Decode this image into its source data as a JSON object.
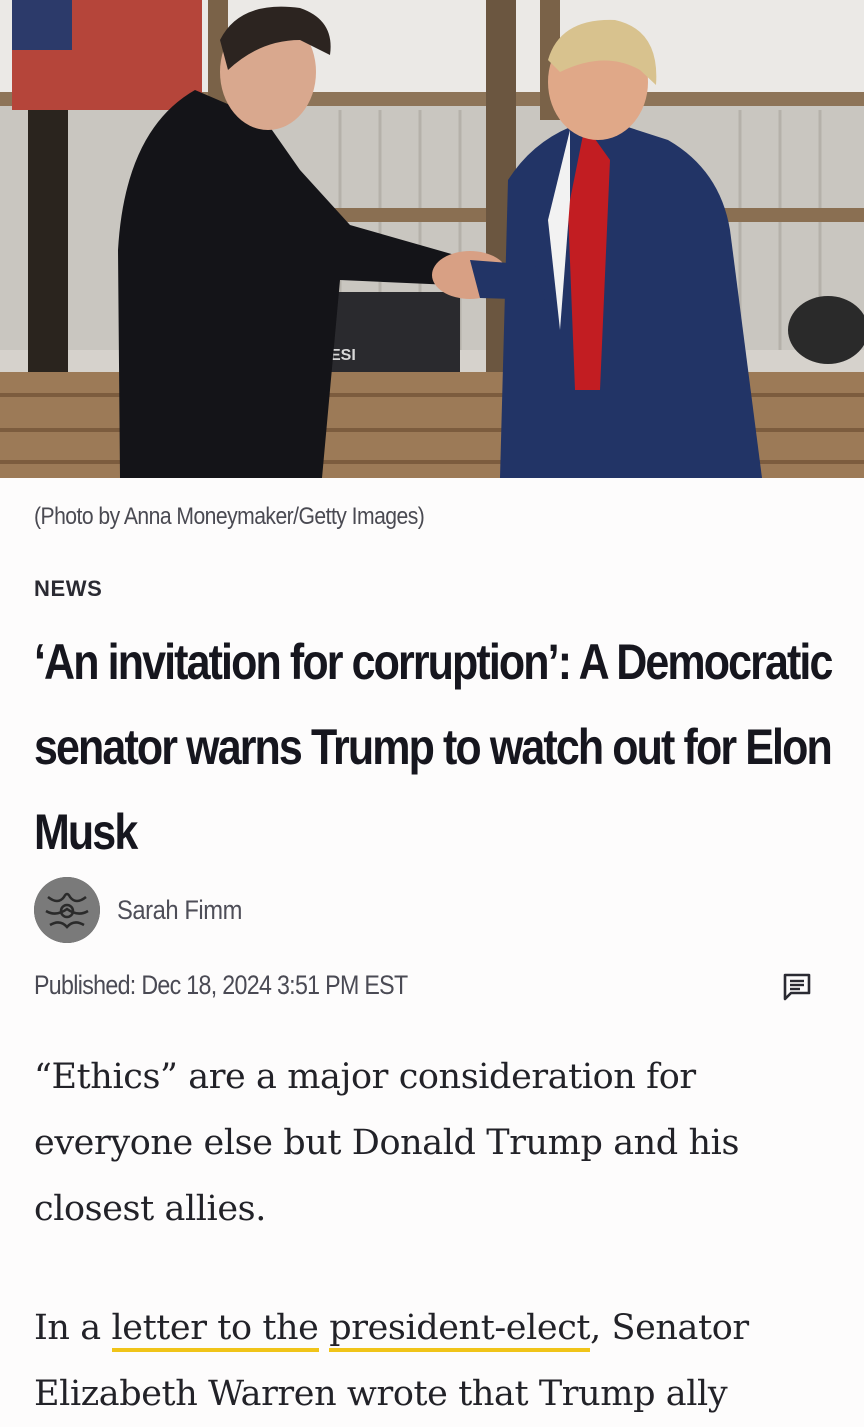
{
  "hero": {
    "image_icon": "photo-handshake",
    "sign_text": "ESI"
  },
  "article": {
    "photo_credit": "(Photo by Anna Moneymaker/Getty Images)",
    "section": "NEWS",
    "headline": "‘An invitation for corruption’: A Democratic senator warns Trump to watch out for Elon Musk",
    "author": {
      "name": "Sarah Fimm",
      "avatar_icon": "author-avatar"
    },
    "published": "Published: Dec 18, 2024 3:51 PM EST",
    "comment_icon": "comment-icon",
    "paragraph1": "“Ethics” are a major consideration for everyone else but Donald Trump and his closest allies.",
    "paragraph2": {
      "pre": "In a ",
      "link1": "letter to the",
      "space": " ",
      "link2": "president-elect",
      "post": ", Senator Elizabeth Warren wrote that Trump ally"
    }
  },
  "colors": {
    "link_underline": "#f0c419",
    "headline": "#16161e",
    "background": "#fdfcfc"
  }
}
